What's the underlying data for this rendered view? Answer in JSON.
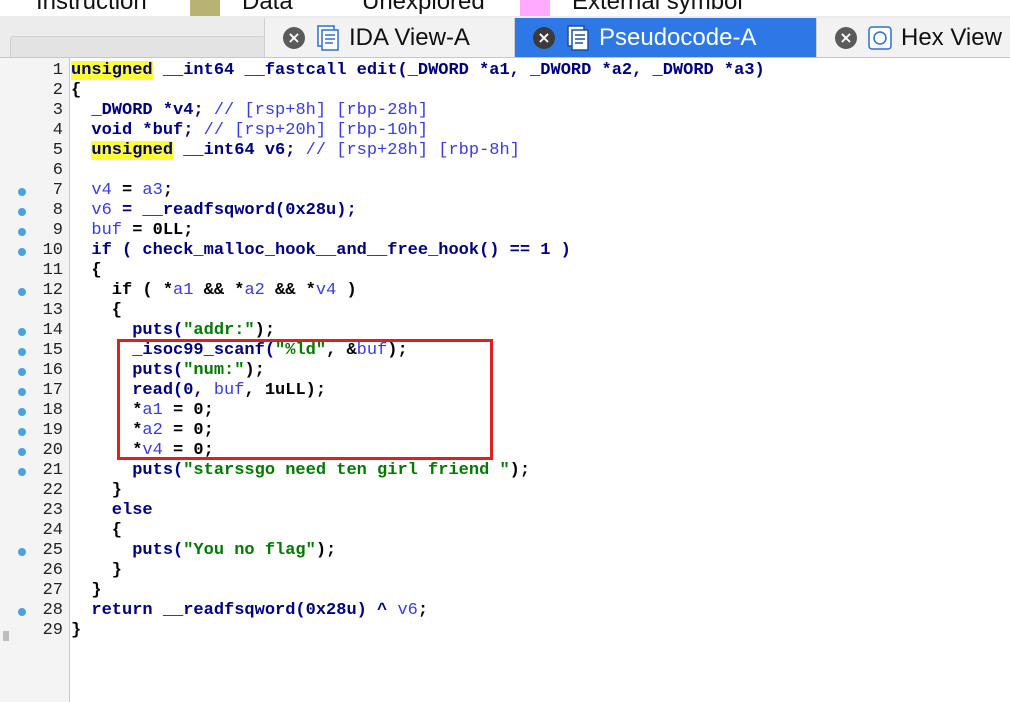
{
  "legend": [
    {
      "label": "Instruction",
      "color": "#c0c0c0"
    },
    {
      "label": "Data",
      "color": "#b8b372"
    },
    {
      "label": "Unexplored",
      "color": "#ffffff"
    },
    {
      "label": "External symbol",
      "color": "#ffaaff"
    }
  ],
  "tabs": [
    {
      "label": "IDA View-A",
      "icon": "disassembly-icon",
      "active": false
    },
    {
      "label": "Pseudocode-A",
      "icon": "pseudocode-icon",
      "active": true
    },
    {
      "label": "Hex View",
      "icon": "hex-icon",
      "active": false
    }
  ],
  "code": {
    "line_numbers": [
      "1",
      "2",
      "3",
      "4",
      "5",
      "6",
      "7",
      "8",
      "9",
      "10",
      "11",
      "12",
      "13",
      "14",
      "15",
      "16",
      "17",
      "18",
      "19",
      "20",
      "21",
      "22",
      "23",
      "24",
      "25",
      "26",
      "27",
      "28",
      "29"
    ],
    "breakpoint_color": "#4aa3e0",
    "highlight_box_color": "#e02020",
    "lines": [
      {
        "t": [
          [
            "unsigned",
            "kwh"
          ],
          [
            " __int64 __fastcall edit(_DWORD *a1, _DWORD *a2, _DWORD *a3)",
            "kw"
          ]
        ]
      },
      {
        "t": [
          [
            "{",
            "sym"
          ]
        ]
      },
      {
        "t": [
          [
            "  _DWORD *v4; ",
            "kw"
          ],
          [
            "// [rsp+8h] [rbp-28h]",
            "cmt"
          ]
        ]
      },
      {
        "t": [
          [
            "  void *buf; ",
            "kw"
          ],
          [
            "// [rsp+20h] [rbp-10h]",
            "cmt"
          ]
        ]
      },
      {
        "t": [
          [
            "  ",
            "sym"
          ],
          [
            "unsigned",
            "kwh"
          ],
          [
            " __int64 v6; ",
            "kw"
          ],
          [
            "// [rsp+28h] [rbp-8h]",
            "cmt"
          ]
        ]
      },
      {
        "t": [
          [
            "",
            "sym"
          ]
        ]
      },
      {
        "t": [
          [
            "  ",
            "sym"
          ],
          [
            "v4",
            "var"
          ],
          [
            " = ",
            "sym"
          ],
          [
            "a3",
            "var"
          ],
          [
            ";",
            "sym"
          ]
        ]
      },
      {
        "t": [
          [
            "  ",
            "sym"
          ],
          [
            "v6",
            "var"
          ],
          [
            " = __readfsqword(0x28u);",
            "fn"
          ]
        ]
      },
      {
        "t": [
          [
            "  ",
            "sym"
          ],
          [
            "buf",
            "var"
          ],
          [
            " = 0LL;",
            "sym"
          ]
        ]
      },
      {
        "t": [
          [
            "  if ( check_malloc_hook__and__free_hook() == 1 )",
            "fn"
          ]
        ]
      },
      {
        "t": [
          [
            "  {",
            "sym"
          ]
        ]
      },
      {
        "t": [
          [
            "    if ( *",
            "sym"
          ],
          [
            "a1",
            "var"
          ],
          [
            " && *",
            "sym"
          ],
          [
            "a2",
            "var"
          ],
          [
            " && *",
            "sym"
          ],
          [
            "v4",
            "var"
          ],
          [
            " )",
            "sym"
          ]
        ]
      },
      {
        "t": [
          [
            "    {",
            "sym"
          ]
        ]
      },
      {
        "t": [
          [
            "      puts(",
            "fn"
          ],
          [
            "\"addr:\"",
            "str"
          ],
          [
            ");",
            "sym"
          ]
        ]
      },
      {
        "t": [
          [
            "      _isoc99_scanf(",
            "fn"
          ],
          [
            "\"%ld\"",
            "str"
          ],
          [
            ", &",
            "sym"
          ],
          [
            "buf",
            "var"
          ],
          [
            ");",
            "sym"
          ]
        ]
      },
      {
        "t": [
          [
            "      puts(",
            "fn"
          ],
          [
            "\"num:\"",
            "str"
          ],
          [
            ");",
            "sym"
          ]
        ]
      },
      {
        "t": [
          [
            "      read(0, ",
            "fn"
          ],
          [
            "buf",
            "var"
          ],
          [
            ", 1uLL);",
            "sym"
          ]
        ]
      },
      {
        "t": [
          [
            "      *",
            "sym"
          ],
          [
            "a1",
            "var"
          ],
          [
            " = 0;",
            "sym"
          ]
        ]
      },
      {
        "t": [
          [
            "      *",
            "sym"
          ],
          [
            "a2",
            "var"
          ],
          [
            " = 0;",
            "sym"
          ]
        ]
      },
      {
        "t": [
          [
            "      *",
            "sym"
          ],
          [
            "v4",
            "var"
          ],
          [
            " = 0;",
            "sym"
          ]
        ]
      },
      {
        "t": [
          [
            "      puts(",
            "fn"
          ],
          [
            "\"starssgo need ten girl friend \"",
            "str"
          ],
          [
            ");",
            "sym"
          ]
        ]
      },
      {
        "t": [
          [
            "    }",
            "sym"
          ]
        ]
      },
      {
        "t": [
          [
            "    else",
            "kw"
          ]
        ]
      },
      {
        "t": [
          [
            "    {",
            "sym"
          ]
        ]
      },
      {
        "t": [
          [
            "      puts(",
            "fn"
          ],
          [
            "\"You no flag\"",
            "str"
          ],
          [
            ");",
            "sym"
          ]
        ]
      },
      {
        "t": [
          [
            "    }",
            "sym"
          ]
        ]
      },
      {
        "t": [
          [
            "  }",
            "sym"
          ]
        ]
      },
      {
        "t": [
          [
            "  return __readfsqword(0x28u) ^ ",
            "fn"
          ],
          [
            "v6",
            "var"
          ],
          [
            ";",
            "sym"
          ]
        ]
      },
      {
        "t": [
          [
            "}",
            "sym"
          ]
        ]
      }
    ],
    "dot_lines": [
      7,
      8,
      9,
      10,
      12,
      14,
      15,
      16,
      17,
      18,
      19,
      20,
      21,
      25,
      28
    ]
  }
}
